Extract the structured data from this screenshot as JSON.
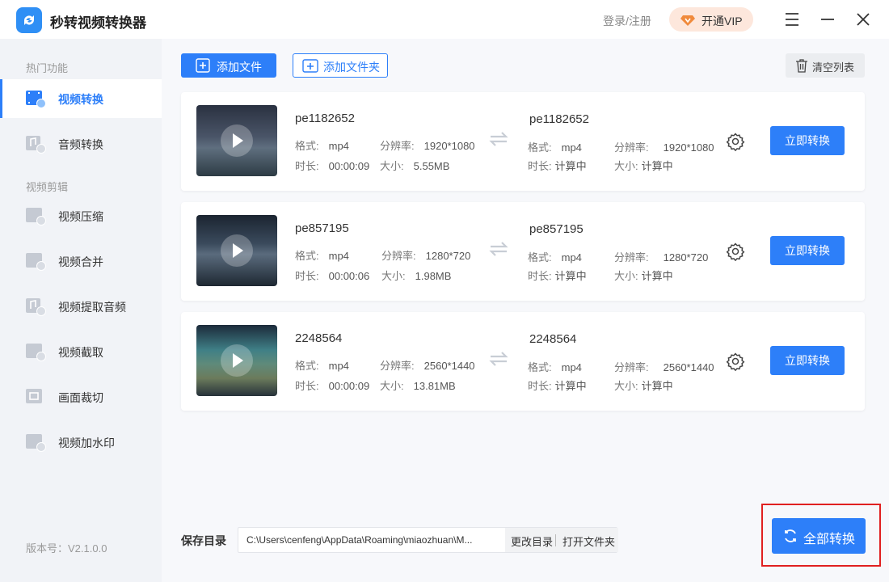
{
  "app": {
    "title": "秒转视频转换器",
    "login": "登录/注册",
    "vip": "开通VIP"
  },
  "colors": {
    "accent": "#2d7ff9",
    "highlight": "#e02020",
    "vip_bg": "#fde7dc",
    "vip_icon": "#f08a3c"
  },
  "sidebar": {
    "section_hot": "热门功能",
    "section_edit": "视频剪辑",
    "items": [
      {
        "label": "视频转换",
        "icon": "video-convert-icon",
        "active": true
      },
      {
        "label": "音频转换",
        "icon": "audio-convert-icon"
      },
      {
        "label": "视频压缩",
        "icon": "video-compress-icon"
      },
      {
        "label": "视频合并",
        "icon": "video-merge-icon"
      },
      {
        "label": "视频提取音频",
        "icon": "extract-audio-icon"
      },
      {
        "label": "视频截取",
        "icon": "video-cut-icon"
      },
      {
        "label": "画面裁切",
        "icon": "crop-icon"
      },
      {
        "label": "视频加水印",
        "icon": "watermark-icon"
      }
    ],
    "version": "版本号：V2.1.0.0"
  },
  "toolbar": {
    "add_file": "添加文件",
    "add_folder": "添加文件夹",
    "clear": "清空列表"
  },
  "files": [
    {
      "name": "pe1182652",
      "format_label": "格式:",
      "format": "mp4",
      "res_label": "分辨率:",
      "resolution": "1920*1080",
      "duration_label": "时长:",
      "duration": "00:00:09",
      "size_label": "大小:",
      "size": "5.55MB",
      "out_name": "pe1182652",
      "out_format": "mp4",
      "out_resolution": "1920*1080",
      "out_duration": "计算中",
      "out_size": "计算中",
      "convert": "立即转换"
    },
    {
      "name": "pe857195",
      "format_label": "格式:",
      "format": "mp4",
      "res_label": "分辨率:",
      "resolution": "1280*720",
      "duration_label": "时长:",
      "duration": "00:00:06",
      "size_label": "大小:",
      "size": "1.98MB",
      "out_name": "pe857195",
      "out_format": "mp4",
      "out_resolution": "1280*720",
      "out_duration": "计算中",
      "out_size": "计算中",
      "convert": "立即转换"
    },
    {
      "name": "2248564",
      "format_label": "格式:",
      "format": "mp4",
      "res_label": "分辨率:",
      "resolution": "2560*1440",
      "duration_label": "时长:",
      "duration": "00:00:09",
      "size_label": "大小:",
      "size": "13.81MB",
      "out_name": "2248564",
      "out_format": "mp4",
      "out_resolution": "2560*1440",
      "out_duration": "计算中",
      "out_size": "计算中",
      "convert": "立即转换"
    }
  ],
  "footer": {
    "save_label": "保存目录",
    "save_path": "C:\\Users\\cenfeng\\AppData\\Roaming\\miaozhuan\\M...",
    "change_dir": "更改目录",
    "open_folder": "打开文件夹",
    "convert_all": "全部转换"
  }
}
